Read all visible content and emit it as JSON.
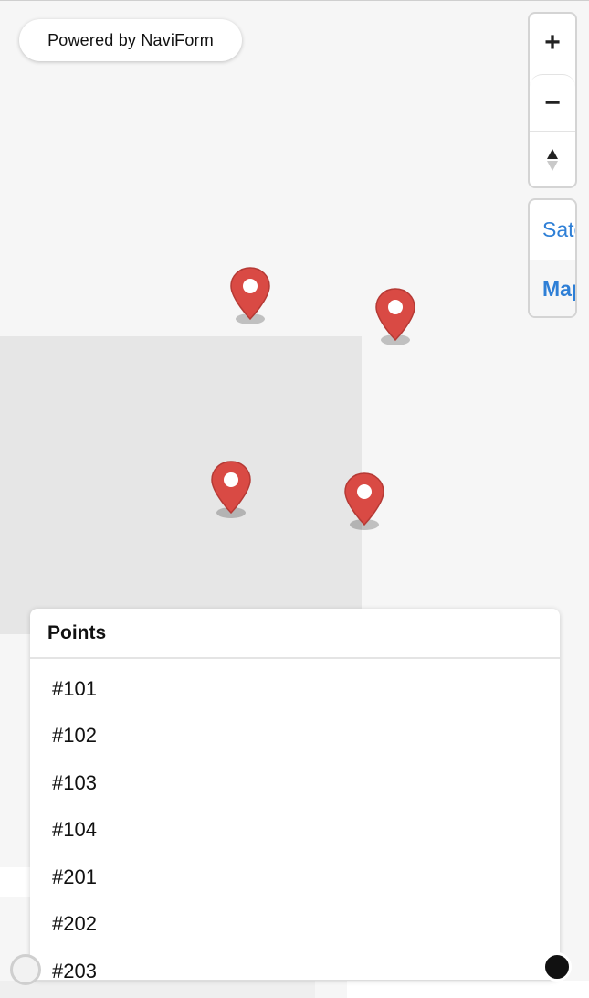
{
  "attribution": {
    "label": "Powered by NaviForm"
  },
  "zoom_controls": {
    "zoom_in_label": "+",
    "zoom_out_label": "−"
  },
  "map_type": {
    "satellite_label": "Satellite",
    "map_label": "Map",
    "selected": "Map",
    "accent_color": "#2e7fd6"
  },
  "markers": {
    "color": "#d94a44",
    "count": 4
  },
  "points_panel": {
    "title": "Points",
    "items": [
      "#101",
      "#102",
      "#103",
      "#104",
      "#201",
      "#202",
      "#203"
    ]
  }
}
